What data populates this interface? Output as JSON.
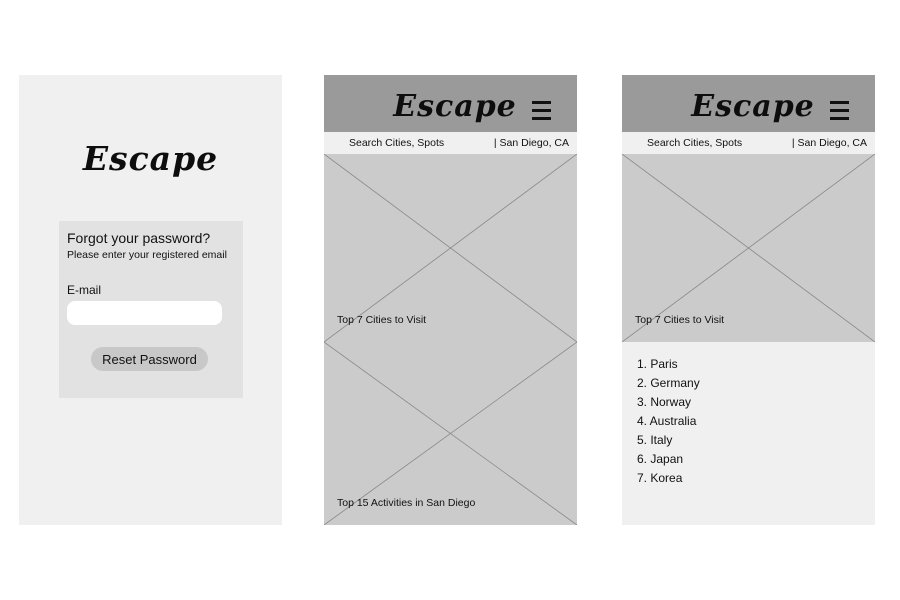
{
  "login": {
    "logo": "Escape",
    "title": "Forgot your password?",
    "subtitle": "Please enter your registered email",
    "email_label": "E-mail",
    "email_value": "",
    "reset_button": "Reset Password"
  },
  "home": {
    "logo": "Escape",
    "menu_icon": "hamburger-menu-icon",
    "search_text": "Search Cities, Spots",
    "location": "| San Diego, CA",
    "cards": [
      {
        "label": "Top 7 Cities to Visit"
      },
      {
        "label": "Top 15 Activities in San Diego"
      }
    ]
  },
  "list": {
    "logo": "Escape",
    "menu_icon": "hamburger-menu-icon",
    "search_text": "Search Cities, Spots",
    "location": "| San Diego, CA",
    "card_label": "Top 7 Cities to Visit",
    "cities": [
      "1. Paris",
      "2. Germany",
      "3. Norway",
      "4. Australia",
      "5. Italy",
      "6. Japan",
      "7. Korea"
    ]
  },
  "colors": {
    "screen_bg": "#f0f0f0",
    "card_bg": "#e2e2e2",
    "header_bg": "#9a9a9a",
    "placeholder_bg": "#cbcbcb",
    "button_bg": "#c8c8c8"
  }
}
